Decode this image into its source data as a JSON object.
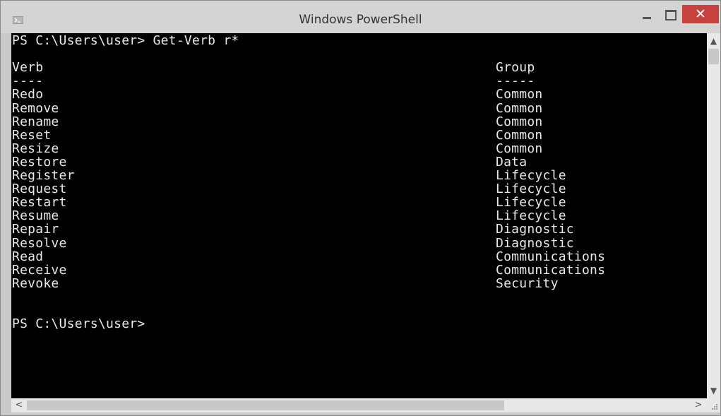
{
  "window": {
    "title": "Windows PowerShell",
    "close_glyph": "✕"
  },
  "console": {
    "lines": [
      {
        "verb": "PS C:\\Users\\user> Get-Verb r*",
        "group": ""
      },
      {
        "verb": "",
        "group": ""
      },
      {
        "verb": "Verb",
        "group": "Group"
      },
      {
        "verb": "----",
        "group": "-----"
      },
      {
        "verb": "Redo",
        "group": "Common"
      },
      {
        "verb": "Remove",
        "group": "Common"
      },
      {
        "verb": "Rename",
        "group": "Common"
      },
      {
        "verb": "Reset",
        "group": "Common"
      },
      {
        "verb": "Resize",
        "group": "Common"
      },
      {
        "verb": "Restore",
        "group": "Data"
      },
      {
        "verb": "Register",
        "group": "Lifecycle"
      },
      {
        "verb": "Request",
        "group": "Lifecycle"
      },
      {
        "verb": "Restart",
        "group": "Lifecycle"
      },
      {
        "verb": "Resume",
        "group": "Lifecycle"
      },
      {
        "verb": "Repair",
        "group": "Diagnostic"
      },
      {
        "verb": "Resolve",
        "group": "Diagnostic"
      },
      {
        "verb": "Read",
        "group": "Communications"
      },
      {
        "verb": "Receive",
        "group": "Communications"
      },
      {
        "verb": "Revoke",
        "group": "Security"
      },
      {
        "verb": "",
        "group": ""
      },
      {
        "verb": "",
        "group": ""
      },
      {
        "verb": "PS C:\\Users\\user>",
        "group": ""
      }
    ]
  },
  "scrollbars": {
    "up_arrow": "▲",
    "down_arrow": "▼",
    "left_arrow": "<",
    "right_arrow": ">"
  },
  "icons": [
    "powershell-app-icon",
    "minimize-icon",
    "maximize-icon",
    "close-icon",
    "scroll-up-icon",
    "scroll-down-icon",
    "scroll-left-icon",
    "scroll-right-icon",
    "resize-grip-icon"
  ]
}
